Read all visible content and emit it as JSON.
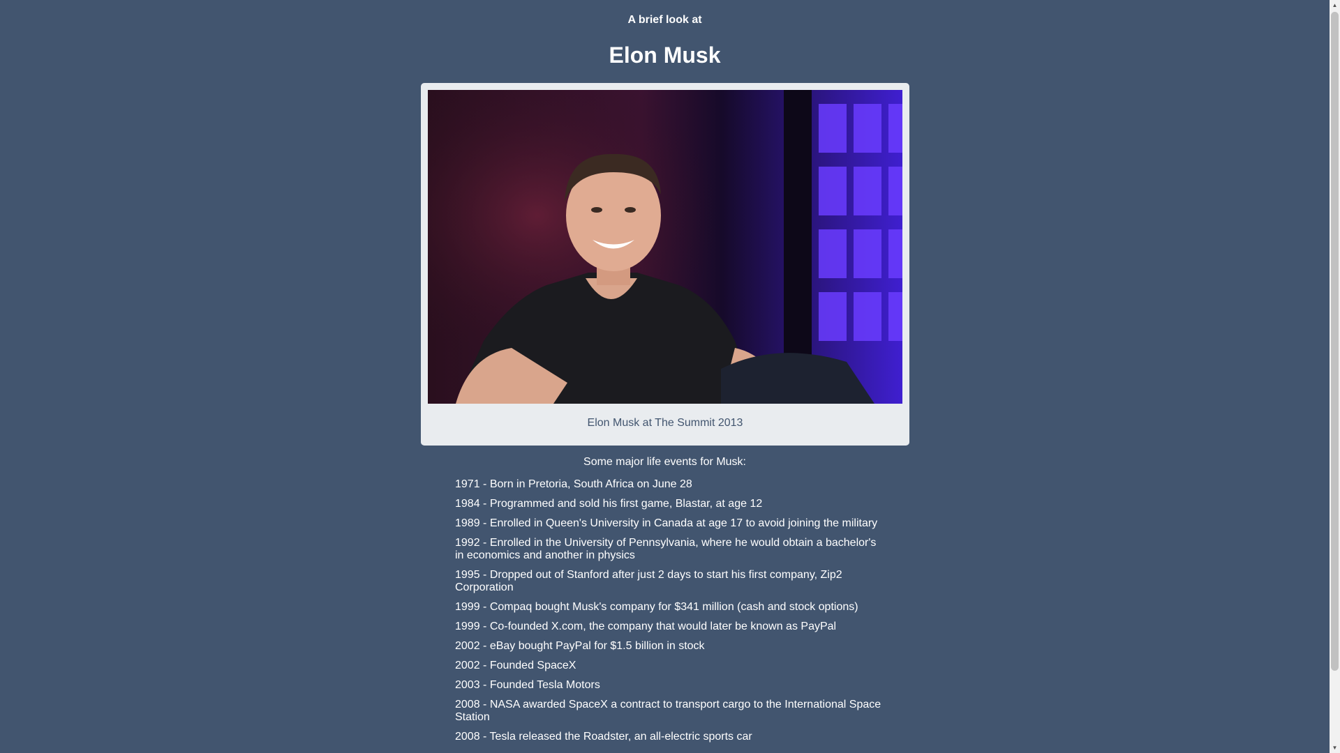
{
  "header": {
    "kicker": "A brief look at",
    "title": "Elon Musk"
  },
  "figure": {
    "image_alt": "Elon Musk at The Summit 2013",
    "caption": "Elon Musk at The Summit 2013"
  },
  "events": {
    "heading": "Some major life events for Musk:",
    "items": [
      "1971 - Born in Pretoria, South Africa on June 28",
      "1984 - Programmed and sold his first game, Blastar, at age 12",
      "1989 - Enrolled in Queen's University in Canada at age 17 to avoid joining the military",
      "1992 - Enrolled in the University of Pennsylvania, where he would obtain a bachelor's in economics and another in physics",
      "1995 - Dropped out of Stanford after just 2 days to start his first company, Zip2 Corporation",
      "1999 - Compaq bought Musk's company for $341 million (cash and stock options)",
      "1999 - Co-founded X.com, the company that would later be known as PayPal",
      "2002 - eBay bought PayPal for $1.5 billion in stock",
      "2002 - Founded SpaceX",
      "2003 - Founded Tesla Motors",
      "2008 - NASA awarded SpaceX a contract to transport cargo to the International Space Station",
      "2008 - Tesla released the Roadster, an all-electric sports car"
    ]
  },
  "colors": {
    "background": "#42556f",
    "card": "#e9ecef",
    "text": "#ffffff"
  }
}
